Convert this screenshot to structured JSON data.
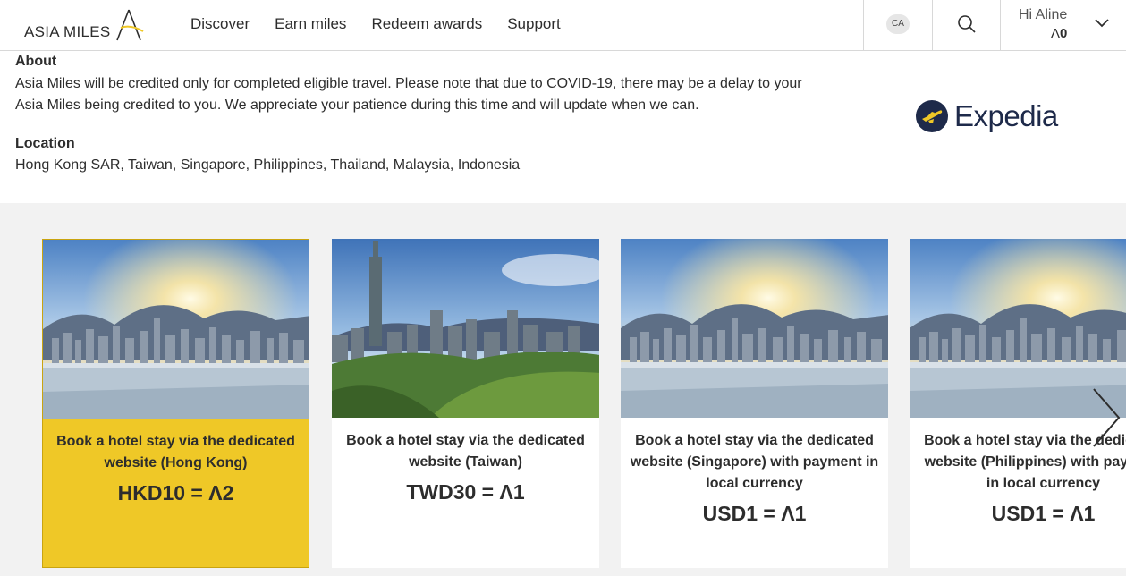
{
  "header": {
    "logo_text": "ASIA MILES",
    "nav": [
      "Discover",
      "Earn miles",
      "Redeem awards",
      "Support"
    ],
    "lang": "CA",
    "greeting": "Hi Aline",
    "miles_balance": "0",
    "miles_symbol": "Λ"
  },
  "about": {
    "title": "About",
    "text": "Asia Miles will be credited only for completed eligible travel. Please note that due to COVID-19, there may be a delay to your Asia Miles being credited to you. We appreciate your patience during this time and will update when we can.",
    "location_title": "Location",
    "location_text": "Hong Kong SAR, Taiwan, Singapore, Philippines, Thailand, Malaysia, Indonesia",
    "partner_name": "Expedia"
  },
  "cards": [
    {
      "title": "Book a hotel stay via the dedicated website (Hong Kong)",
      "rate": "HKD10 = ",
      "miles": "2",
      "scene": "hongkong",
      "active": true
    },
    {
      "title": "Book a hotel stay via the dedicated website (Taiwan)",
      "rate": "TWD30 = ",
      "miles": "1",
      "scene": "taipei",
      "active": false
    },
    {
      "title": "Book a hotel stay via the dedicated website (Singapore) with payment in local currency",
      "rate": "USD1 = ",
      "miles": "1",
      "scene": "hongkong",
      "active": false
    },
    {
      "title": "Book a hotel stay via the dedicated website (Philippines) with payment in local currency",
      "rate": "USD1 = ",
      "miles": "1",
      "scene": "hongkong",
      "active": false
    }
  ],
  "colors": {
    "accent": "#efc827",
    "text": "#2d2d2d",
    "expedia_navy": "#1e2a4a",
    "strip_bg": "#f2f2f2"
  }
}
